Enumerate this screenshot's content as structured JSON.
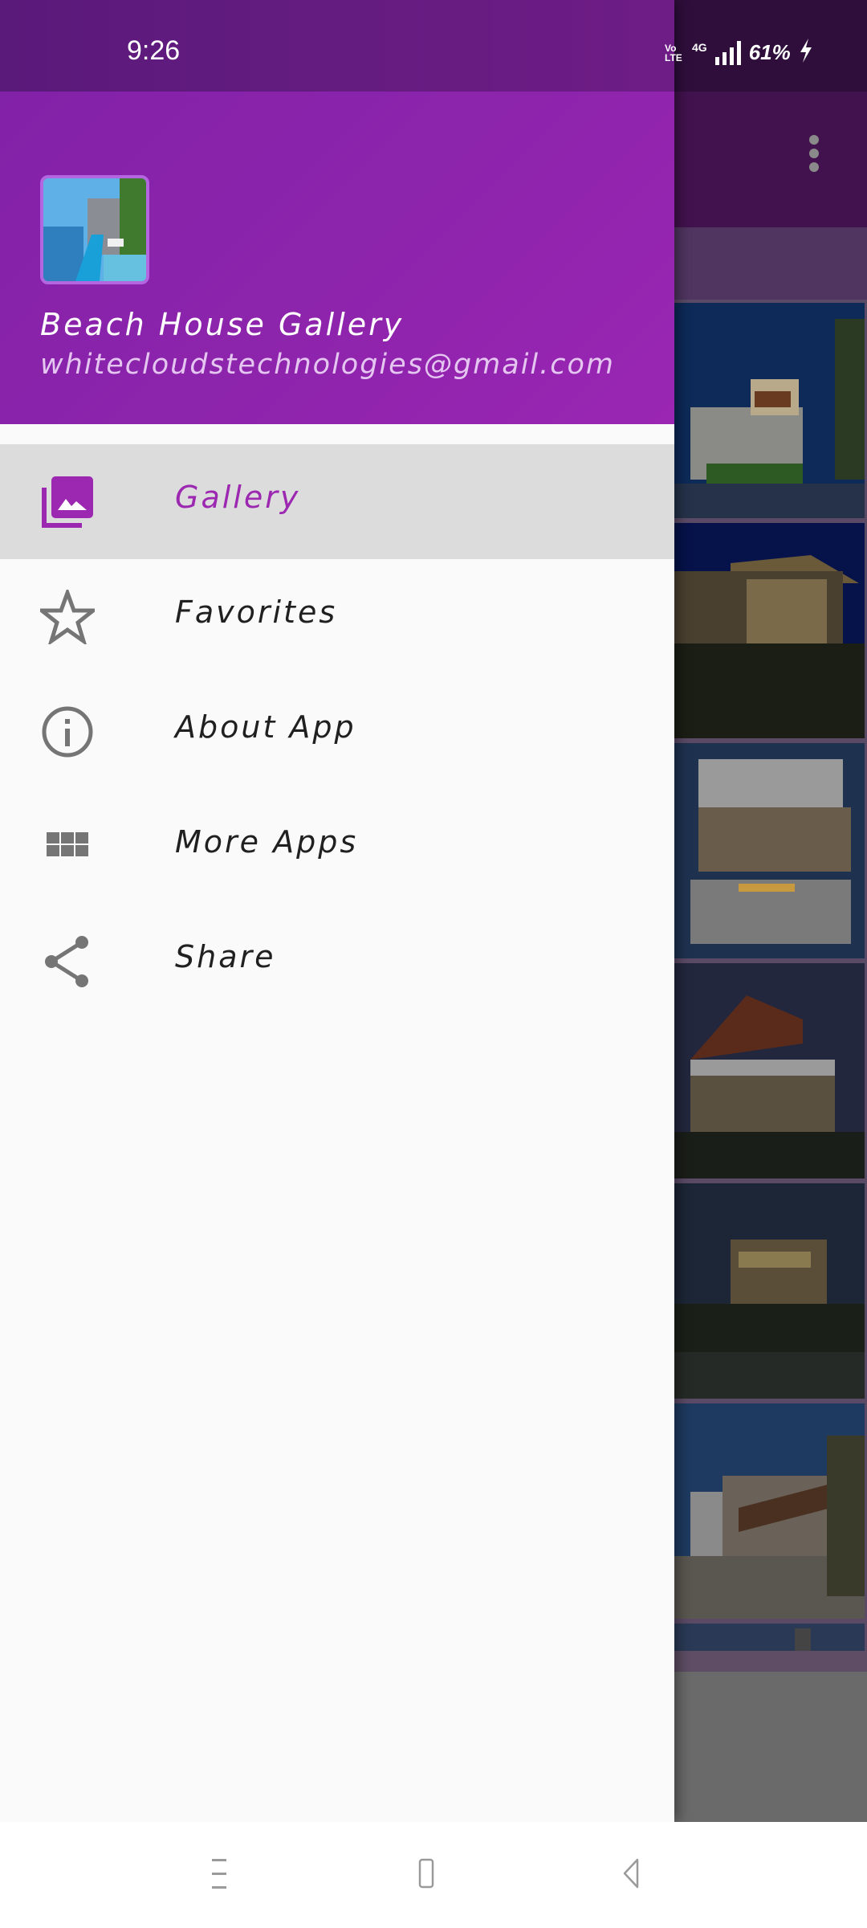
{
  "status_bar": {
    "time": "9:26",
    "volte": "Vo LTE",
    "network": "4G",
    "battery": "61%",
    "charging_icon": "lightning-bolt-icon"
  },
  "drawer": {
    "header": {
      "app_title": "Beach House Gallery",
      "email": "whitecloudstechnologies@gmail.com",
      "avatar_icon": "beach-house-pool-thumbnail"
    },
    "items": [
      {
        "label": "Gallery",
        "icon": "photo-library-icon",
        "selected": true
      },
      {
        "label": "Favorites",
        "icon": "star-outline-icon",
        "selected": false
      },
      {
        "label": "About App",
        "icon": "info-outline-icon",
        "selected": false
      },
      {
        "label": "More Apps",
        "icon": "grid-apps-icon",
        "selected": false
      },
      {
        "label": "Share",
        "icon": "share-icon",
        "selected": false
      }
    ]
  },
  "background_app": {
    "toolbar_menu_icon": "overflow-menu-icon",
    "photos": [
      "beach-house-night-1",
      "beach-house-night-2",
      "beach-house-patio-fire",
      "beach-house-dusk-terrace",
      "beach-house-lit-windows",
      "beach-house-palm-entrance"
    ]
  },
  "nav_bar": {
    "recents_icon": "recents-icon",
    "home_icon": "home-icon",
    "back_icon": "back-icon"
  },
  "colors": {
    "primary": "#8e24aa",
    "accent_selected": "#9c27b0",
    "selected_row_bg": "#dcdcdc",
    "drawer_bg": "#fafafa",
    "icon_grey": "#757575"
  }
}
